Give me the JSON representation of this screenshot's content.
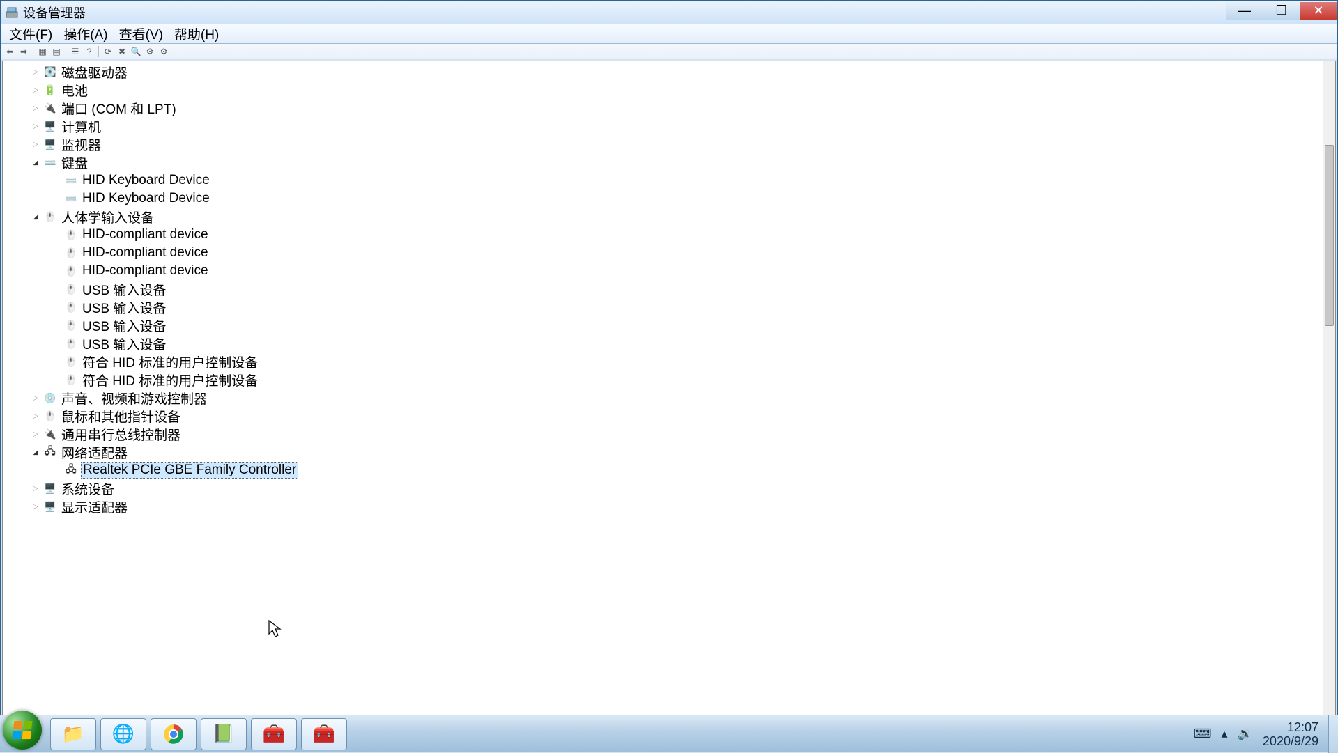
{
  "window": {
    "title": "设备管理器"
  },
  "menu": {
    "file": "文件(F)",
    "action": "操作(A)",
    "view": "查看(V)",
    "help": "帮助(H)"
  },
  "tree": [
    {
      "level": 1,
      "icon": "disk-drive-icon",
      "label": "磁盘驱动器",
      "state": "collapsed"
    },
    {
      "level": 1,
      "icon": "battery-icon",
      "label": "电池",
      "state": "collapsed"
    },
    {
      "level": 1,
      "icon": "port-icon",
      "label": "端口 (COM 和 LPT)",
      "state": "collapsed"
    },
    {
      "level": 1,
      "icon": "computer-icon",
      "label": "计算机",
      "state": "collapsed"
    },
    {
      "level": 1,
      "icon": "monitor-icon",
      "label": "监视器",
      "state": "collapsed"
    },
    {
      "level": 1,
      "icon": "keyboard-icon",
      "label": "键盘",
      "state": "expanded"
    },
    {
      "level": 2,
      "icon": "keyboard-icon",
      "label": "HID Keyboard Device",
      "state": "none"
    },
    {
      "level": 2,
      "icon": "keyboard-icon",
      "label": "HID Keyboard Device",
      "state": "none"
    },
    {
      "level": 1,
      "icon": "hid-icon",
      "label": "人体学输入设备",
      "state": "expanded"
    },
    {
      "level": 2,
      "icon": "hid-icon",
      "label": "HID-compliant device",
      "state": "none"
    },
    {
      "level": 2,
      "icon": "hid-icon",
      "label": "HID-compliant device",
      "state": "none"
    },
    {
      "level": 2,
      "icon": "hid-icon",
      "label": "HID-compliant device",
      "state": "none"
    },
    {
      "level": 2,
      "icon": "hid-icon",
      "label": "USB 输入设备",
      "state": "none"
    },
    {
      "level": 2,
      "icon": "hid-icon",
      "label": "USB 输入设备",
      "state": "none"
    },
    {
      "level": 2,
      "icon": "hid-icon",
      "label": "USB 输入设备",
      "state": "none"
    },
    {
      "level": 2,
      "icon": "hid-icon",
      "label": "USB 输入设备",
      "state": "none"
    },
    {
      "level": 2,
      "icon": "hid-icon",
      "label": "符合 HID 标准的用户控制设备",
      "state": "none"
    },
    {
      "level": 2,
      "icon": "hid-icon",
      "label": "符合 HID 标准的用户控制设备",
      "state": "none"
    },
    {
      "level": 1,
      "icon": "sound-icon",
      "label": "声音、视频和游戏控制器",
      "state": "collapsed"
    },
    {
      "level": 1,
      "icon": "mouse-icon",
      "label": "鼠标和其他指针设备",
      "state": "collapsed"
    },
    {
      "level": 1,
      "icon": "usb-icon",
      "label": "通用串行总线控制器",
      "state": "collapsed"
    },
    {
      "level": 1,
      "icon": "network-icon",
      "label": "网络适配器",
      "state": "expanded"
    },
    {
      "level": 2,
      "icon": "network-icon",
      "label": "Realtek PCIe GBE Family Controller",
      "state": "none",
      "selected": true
    },
    {
      "level": 1,
      "icon": "system-icon",
      "label": "系统设备",
      "state": "collapsed"
    },
    {
      "level": 1,
      "icon": "display-icon",
      "label": "显示适配器",
      "state": "collapsed"
    }
  ],
  "taskbar": {
    "items": [
      "explorer",
      "browser-360",
      "chrome",
      "notepad",
      "toolbox-1",
      "toolbox-2"
    ],
    "time": "12:07",
    "date": "2020/9/29"
  },
  "icon_glyphs": {
    "disk-drive-icon": "💽",
    "battery-icon": "🔋",
    "port-icon": "🔌",
    "computer-icon": "🖥️",
    "monitor-icon": "🖥️",
    "keyboard-icon": "⌨️",
    "hid-icon": "🖱️",
    "sound-icon": "💿",
    "mouse-icon": "🖱️",
    "usb-icon": "🔌",
    "network-icon": "🖧",
    "system-icon": "🖥️",
    "display-icon": "🖥️"
  }
}
